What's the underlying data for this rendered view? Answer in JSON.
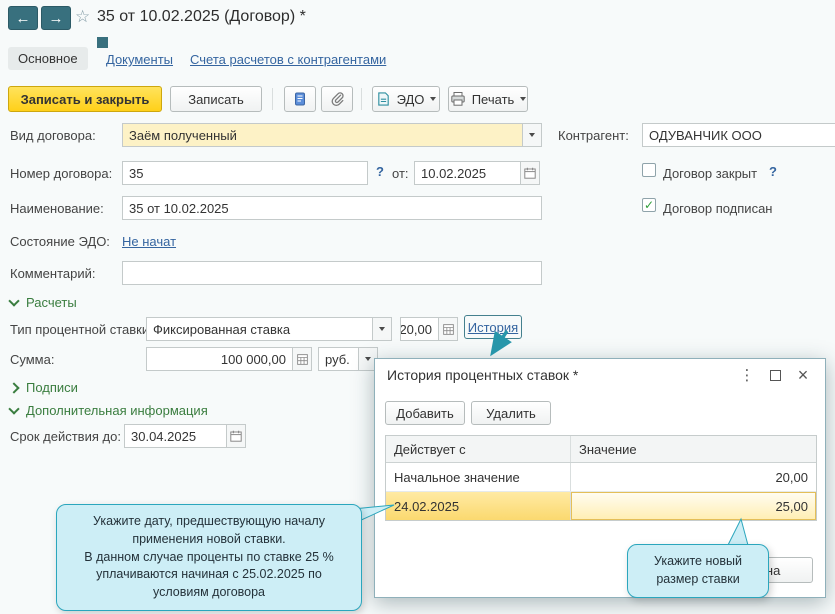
{
  "window": {
    "title": "35 от 10.02.2025 (Договор) *",
    "tabs": [
      {
        "label": "Основное"
      },
      {
        "label": "Документы"
      },
      {
        "label": "Счета расчетов с контрагентами"
      }
    ]
  },
  "toolbar": {
    "save_close": "Записать и закрыть",
    "save": "Записать",
    "edo": "ЭДО",
    "print": "Печать"
  },
  "form": {
    "contract_kind_label": "Вид договора:",
    "contract_kind_value": "Заём полученный",
    "counterparty_label": "Контрагент:",
    "counterparty_value": "ОДУВАНЧИК ООО",
    "number_label": "Номер договора:",
    "number_value": "35",
    "date_prefix": "от:",
    "date_value": "10.02.2025",
    "contract_closed_label": "Договор закрыт",
    "contract_signed_label": "Договор подписан",
    "name_label": "Наименование:",
    "name_value": "35 от 10.02.2025",
    "edo_status_label": "Состояние ЭДО:",
    "edo_status_value": "Не начат",
    "comment_label": "Комментарий:",
    "comment_value": "",
    "section_calculations": "Расчеты",
    "rate_type_label": "Тип процентной ставки:",
    "rate_type_value": "Фиксированная ставка",
    "rate_value": "20,00",
    "history_link": "История",
    "amount_label": "Сумма:",
    "amount_value": "100 000,00",
    "currency_value": "руб.",
    "section_signatures": "Подписи",
    "section_additional": "Дополнительная информация",
    "valid_until_label": "Срок действия до:",
    "valid_until_value": "30.04.2025"
  },
  "popup": {
    "title": "История процентных ставок *",
    "add_button": "Добавить",
    "delete_button": "Удалить",
    "table": {
      "headers": [
        "Действует с",
        "Значение"
      ],
      "rows": [
        {
          "effective_from": "Начальное значение",
          "value": "20,00"
        },
        {
          "effective_from": "24.02.2025",
          "value": "25,00"
        }
      ]
    },
    "cancel_button": "Отмена"
  },
  "callouts": {
    "left_line1": "Укажите дату, предшествующую началу применения новой ставки.",
    "left_line2": "В данном случае проценты по ставке 25 % уплачиваются начиная с 25.02.2025 по условиям договора",
    "bottom": "Укажите новый размер ставки"
  },
  "icons": {
    "back": "←",
    "forward": "→",
    "star": "☆",
    "hint": "?",
    "more": "⋮",
    "close": "×",
    "check": "✓"
  }
}
